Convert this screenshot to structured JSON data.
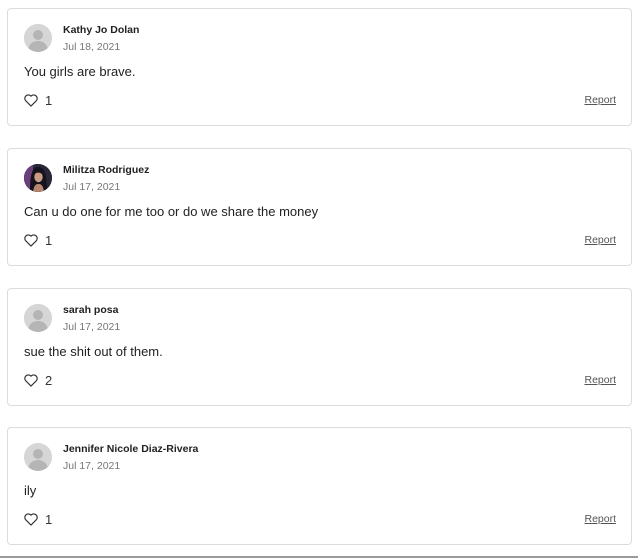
{
  "comments": [
    {
      "author": "Kathy Jo Dolan",
      "date": "Jul 18, 2021",
      "text": "You girls are brave.",
      "likes": "1",
      "report_label": "Report",
      "avatar": "default-avatar-icon"
    },
    {
      "author": "Militza Rodriguez",
      "date": "Jul 17, 2021",
      "text": "Can u do one for me too or do we share the money",
      "likes": "1",
      "report_label": "Report",
      "avatar": "profile-photo"
    },
    {
      "author": "sarah posa",
      "date": "Jul 17, 2021",
      "text": "sue the shit out of them.",
      "likes": "2",
      "report_label": "Report",
      "avatar": "default-avatar-icon"
    },
    {
      "author": "Jennifer Nicole Diaz-Rivera",
      "date": "Jul 17, 2021",
      "text": "ily",
      "likes": "1",
      "report_label": "Report",
      "avatar": "default-avatar-icon"
    }
  ],
  "icons": {
    "like": "heart-outline-icon"
  },
  "colors": {
    "card_border": "#dcdcdc",
    "secondary_text": "#777777",
    "avatar_placeholder": "#d6d6d6"
  }
}
